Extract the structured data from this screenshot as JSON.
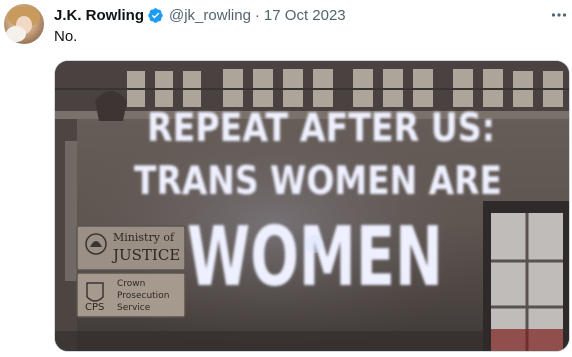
{
  "tweet": {
    "author_name": "J.K. Rowling",
    "handle": "@jk_rowling",
    "separator": "·",
    "date": "17 Oct 2023",
    "text": "No.",
    "verified_color": "#1d9bf0",
    "icons": {
      "verified": "verified-badge-icon",
      "more": "more-options-icon"
    }
  },
  "photo": {
    "projection_lines": [
      "REPEAT AFTER US:",
      "TRANS WOMEN ARE",
      "WOMEN"
    ],
    "sign_justice_line1": "Ministry of",
    "sign_justice_line2": "JUSTICE",
    "sign_cps_abbr": "CPS",
    "sign_cps_line1": "Crown",
    "sign_cps_line2": "Prosecution",
    "sign_cps_line3": "Service"
  }
}
